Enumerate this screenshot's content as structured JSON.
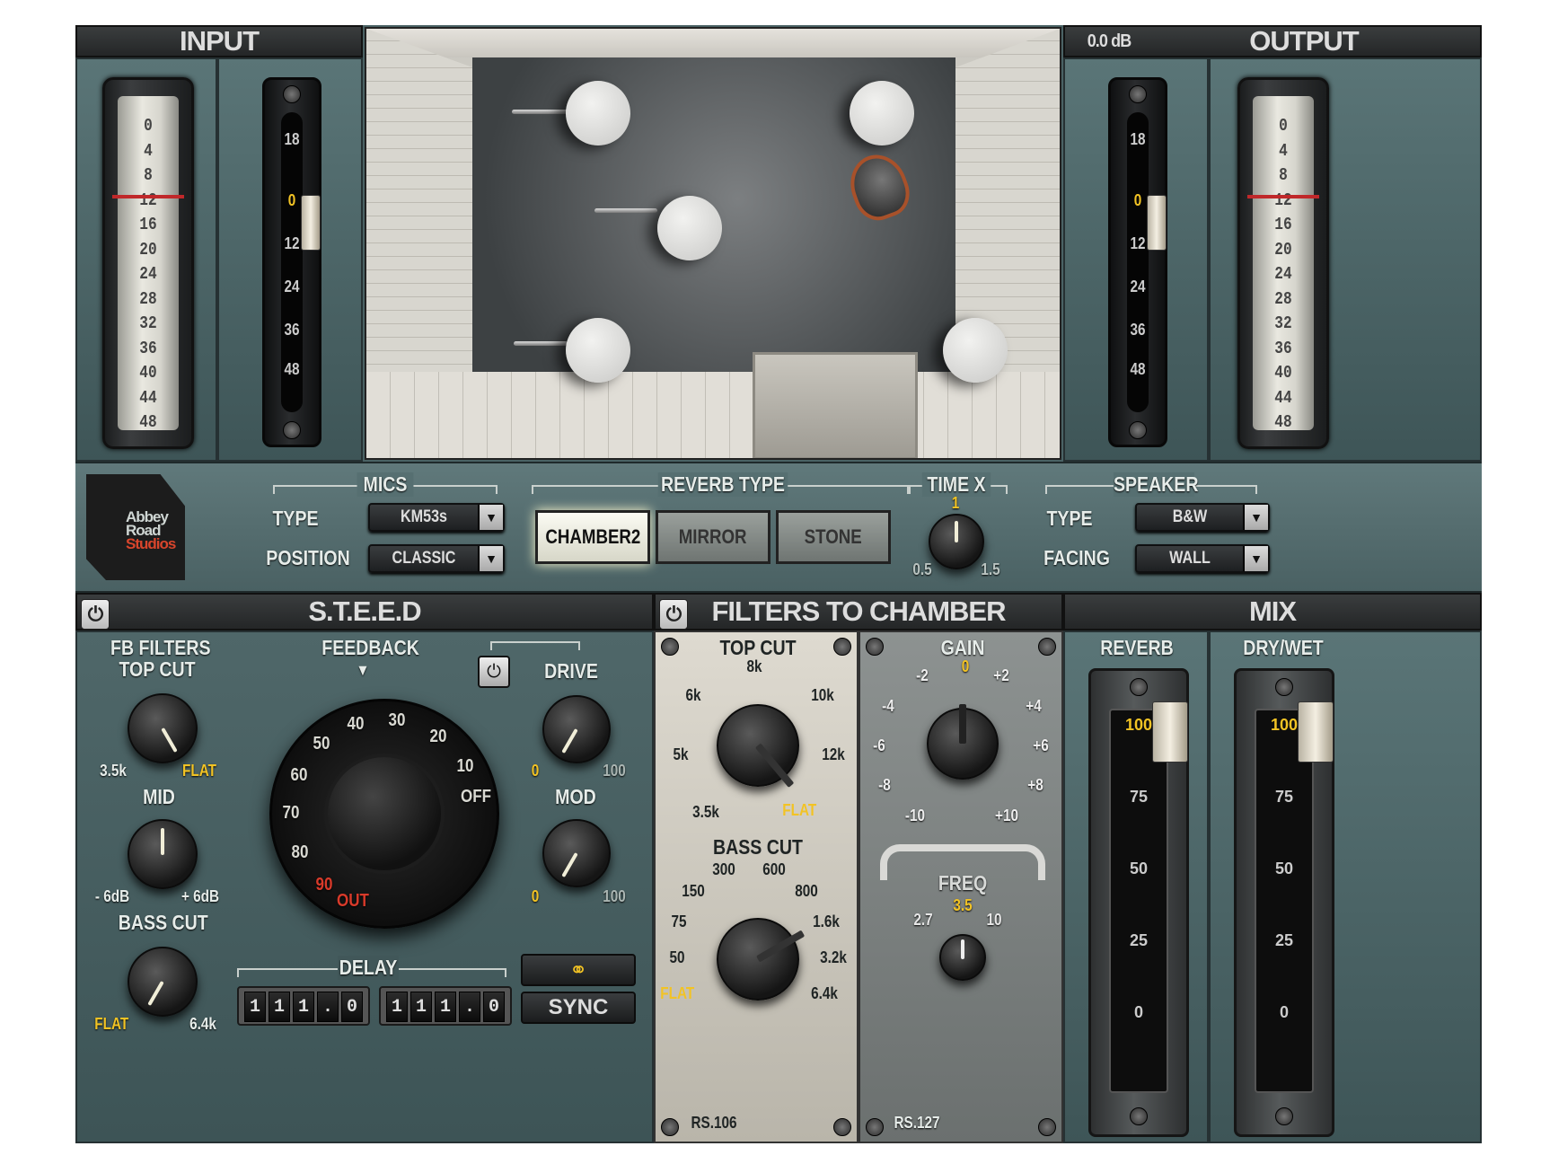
{
  "input": {
    "title": "INPUT",
    "meter_scale": [
      "0",
      "4",
      "8",
      "12",
      "16",
      "20",
      "24",
      "28",
      "32",
      "36",
      "40",
      "44",
      "48"
    ],
    "trim_scale": [
      "18",
      "0",
      "12",
      "24",
      "36",
      "48"
    ]
  },
  "output": {
    "title": "OUTPUT",
    "level_readout": "0.0 dB",
    "meter_scale": [
      "0",
      "4",
      "8",
      "12",
      "16",
      "20",
      "24",
      "28",
      "32",
      "36",
      "40",
      "44",
      "48"
    ],
    "trim_scale": [
      "18",
      "0",
      "12",
      "24",
      "36",
      "48"
    ]
  },
  "logo": {
    "line1": "Abbey",
    "line2": "Road",
    "line3": "Studios"
  },
  "mics": {
    "section": "MICS",
    "type_label": "TYPE",
    "type_value": "KM53s",
    "position_label": "POSITION",
    "position_value": "CLASSIC"
  },
  "reverb_type": {
    "section": "REVERB TYPE",
    "options": [
      "CHAMBER2",
      "MIRROR",
      "STONE"
    ],
    "selected": "CHAMBER2"
  },
  "time_x": {
    "section": "TIME X",
    "top": "1",
    "left": "0.5",
    "right": "1.5"
  },
  "speaker": {
    "section": "SPEAKER",
    "type_label": "TYPE",
    "type_value": "B&W",
    "facing_label": "FACING",
    "facing_value": "WALL"
  },
  "steed": {
    "title": "S.T.E.E.D",
    "fb_filters_line1": "FB FILTERS",
    "top_cut": "TOP CUT",
    "top_cut_min": "3.5k",
    "top_cut_max": "FLAT",
    "mid": "MID",
    "mid_min": "- 6dB",
    "mid_max": "+ 6dB",
    "bass_cut": "BASS CUT",
    "bass_cut_min": "FLAT",
    "bass_cut_max": "6.4k",
    "feedback": "FEEDBACK",
    "feedback_marker": "▼",
    "feedback_scale": [
      "OFF",
      "10",
      "20",
      "30",
      "40",
      "50",
      "60",
      "70",
      "80",
      "90",
      "OUT"
    ],
    "drive": "DRIVE",
    "drive_min": "0",
    "drive_max": "100",
    "mod": "MOD",
    "mod_min": "0",
    "mod_max": "100",
    "delay": "DELAY",
    "delay_left": [
      "1",
      "1",
      "1",
      ".",
      "0"
    ],
    "delay_right": [
      "1",
      "1",
      "1",
      ".",
      "0"
    ],
    "link_icon": "link-icon",
    "sync": "SYNC"
  },
  "filters": {
    "title": "FILTERS TO CHAMBER",
    "top_cut": "TOP CUT",
    "top_cut_scale": [
      "3.5k",
      "5k",
      "6k",
      "8k",
      "10k",
      "12k",
      "FLAT"
    ],
    "bass_cut": "BASS CUT",
    "bass_cut_scale": [
      "FLAT",
      "50",
      "75",
      "150",
      "300",
      "600",
      "800",
      "1.6k",
      "3.2k",
      "6.4k"
    ],
    "model_left": "RS.106",
    "gain": "GAIN",
    "gain_scale": [
      "-2",
      "0",
      "+2",
      "-4",
      "+4",
      "-6",
      "+6",
      "-8",
      "+8",
      "-10",
      "+10"
    ],
    "freq": "FREQ",
    "freq_low": "2.7",
    "freq_mid": "3.5",
    "freq_high": "10",
    "model_right": "RS.127"
  },
  "mix": {
    "title": "MIX",
    "reverb": "REVERB",
    "drywet": "DRY/WET",
    "scale": [
      "100",
      "75",
      "50",
      "25",
      "0"
    ]
  },
  "colors": {
    "accent_yellow": "#f2c324",
    "panel": "#4a6264",
    "header": "#2b2e2f"
  }
}
